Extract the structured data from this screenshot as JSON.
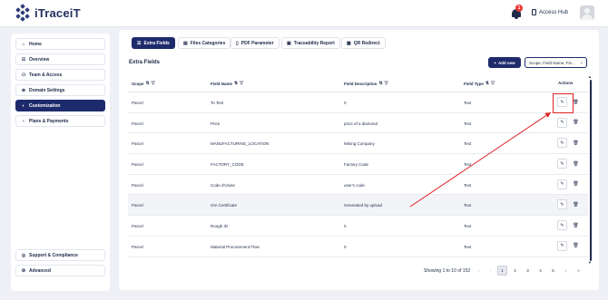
{
  "header": {
    "logo_text": "iTraceiT",
    "notification_count": "1",
    "access_hub_label": "Access Hub"
  },
  "sidebar": {
    "items": [
      {
        "label": "Home",
        "icon": "home-icon"
      },
      {
        "label": "Overview",
        "icon": "grid-icon"
      },
      {
        "label": "Team & Access",
        "icon": "team-icon"
      },
      {
        "label": "Domain Settings",
        "icon": "globe-icon"
      },
      {
        "label": "Customization",
        "icon": "palette-icon",
        "active": true
      },
      {
        "label": "Plans & Payments",
        "icon": "chevron-left-icon"
      }
    ],
    "bottom_items": [
      {
        "label": "Support & Compliance",
        "icon": "support-icon"
      },
      {
        "label": "Advanced",
        "icon": "gear-icon"
      }
    ]
  },
  "tabs": [
    {
      "label": "Extra Fields",
      "active": true
    },
    {
      "label": "Files Categories"
    },
    {
      "label": "PDF Parameter"
    },
    {
      "label": "Traceability Report"
    },
    {
      "label": "QR Redirect"
    }
  ],
  "section_title": "Extra Fields",
  "add_button_label": "Add new",
  "scope_select_value": "Scope, Field Name, Fie...",
  "table": {
    "headers": [
      "Scope",
      "Field Name",
      "Field Description",
      "Field Type",
      "Actions"
    ],
    "rows": [
      {
        "scope": "Parcel",
        "name": "To Test",
        "description": "0",
        "type": "Text"
      },
      {
        "scope": "Parcel",
        "name": "Price",
        "description": "price of a diamond",
        "type": "Text"
      },
      {
        "scope": "Parcel",
        "name": "MANUFACTURING_LOCATION",
        "description": "Mining Company",
        "type": "Text"
      },
      {
        "scope": "Parcel",
        "name": "FACTORY_CODE",
        "description": "Factory Code",
        "type": "Text"
      },
      {
        "scope": "Parcel",
        "name": "Code d'Usine",
        "description": "user's code",
        "type": "Text"
      },
      {
        "scope": "Parcel",
        "name": "GIA Certificate",
        "description": "Generated by upload",
        "type": "Text"
      },
      {
        "scope": "Parcel",
        "name": "Rough ID",
        "description": "0",
        "type": "Text"
      },
      {
        "scope": "Parcel",
        "name": "Material Procurement Flow",
        "description": "0",
        "type": "Text"
      }
    ]
  },
  "pagination": {
    "summary": "Showing 1 to 10 of 152",
    "pages": [
      "1",
      "2",
      "3",
      "4",
      "5"
    ],
    "current_page": "1"
  },
  "colors": {
    "accent": "#1d2a6b",
    "annotation": "#e02020"
  }
}
